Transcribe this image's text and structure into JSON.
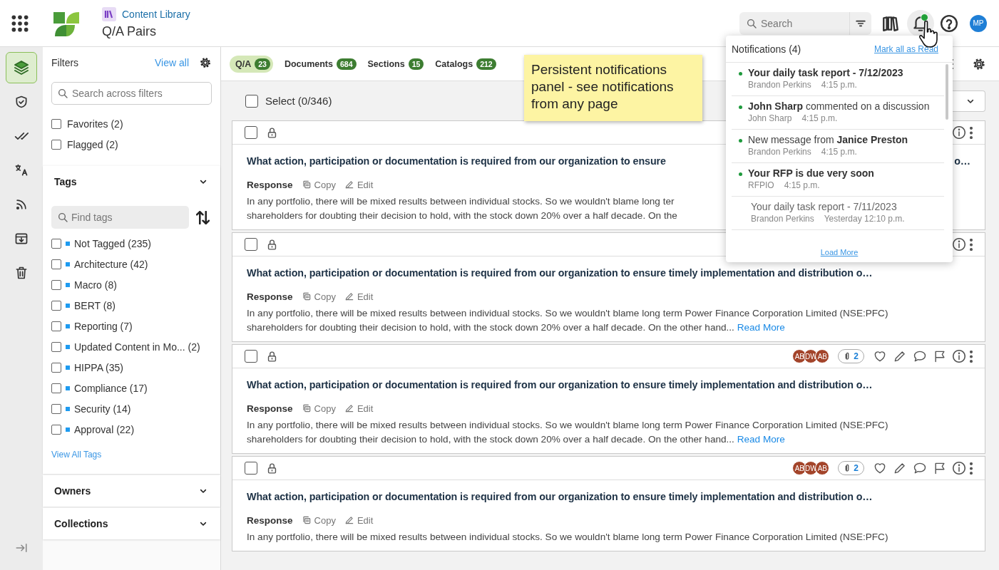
{
  "header": {
    "app_name": "Content Library",
    "page_title": "Q/A Pairs",
    "search": {
      "placeholder": "Search"
    },
    "notifications_unread": true,
    "avatar": "MP"
  },
  "rail": {
    "items": [
      {
        "selected": true
      },
      {
        "selected": false
      },
      {
        "selected": false
      },
      {
        "selected": false
      },
      {
        "selected": false
      },
      {
        "selected": false
      },
      {
        "selected": false
      }
    ]
  },
  "filters": {
    "title": "Filters",
    "view_all": "View all",
    "search": {
      "placeholder": "Search across filters"
    },
    "quick": [
      {
        "label": "Favorites (2)",
        "checked": false
      },
      {
        "label": "Flagged (2)",
        "checked": false
      }
    ],
    "sections": [
      {
        "title": "Tags",
        "expanded": true,
        "search": {
          "placeholder": "Find tags"
        },
        "items": [
          {
            "label": "Not Tagged (235)",
            "checked": false,
            "color": "#1e9bf0"
          },
          {
            "label": "Architecture (42)",
            "checked": false,
            "color": "#1e9bf0"
          },
          {
            "label": "Macro (8)",
            "checked": false,
            "color": "#1e9bf0"
          },
          {
            "label": "BERT (8)",
            "checked": false,
            "color": "#1e9bf0"
          },
          {
            "label": "Reporting (7)",
            "checked": false,
            "color": "#1e9bf0"
          },
          {
            "label": "Updated Content in Mo... (2)",
            "checked": false,
            "color": "#1e9bf0"
          },
          {
            "label": "HIPPA (35)",
            "checked": false,
            "color": "#1e9bf0"
          },
          {
            "label": "Compliance (17)",
            "checked": false,
            "color": "#1e9bf0"
          },
          {
            "label": "Security (14)",
            "checked": false,
            "color": "#1e9bf0"
          },
          {
            "label": "Approval (22)",
            "checked": false,
            "color": "#1e9bf0"
          }
        ],
        "link": "View All Tags"
      },
      {
        "title": "Owners",
        "expanded": false
      },
      {
        "title": "Collections",
        "expanded": false
      }
    ]
  },
  "tabs": [
    {
      "label": "Q/A",
      "count": "23",
      "selected": true
    },
    {
      "label": "Documents",
      "count": "684",
      "selected": false
    },
    {
      "label": "Sections",
      "count": "15",
      "selected": false
    },
    {
      "label": "Catalogs",
      "count": "212",
      "selected": false
    }
  ],
  "select_all": {
    "label": "Select (0/346)",
    "checked": false
  },
  "cards": [
    {
      "checked": false,
      "title": "What action, participation or documentation is required from our organization to ensure",
      "title_tail": "o…",
      "response_label": "Response",
      "copy": "Copy",
      "edit": "Edit",
      "body": [
        "In any portfolio, there will be mixed results between individual stocks. So we wouldn't blame long ter",
        "shareholders for doubting their decision to hold, with the stock down 20% over a half decade. On the"
      ]
    },
    {
      "checked": false,
      "title": "What action, participation or documentation is required from our organization to ensure timely implementation and distribution o…",
      "response_label": "Response",
      "copy": "Copy",
      "edit": "Edit",
      "body": [
        "In any portfolio, there will be mixed results between individual stocks. So we wouldn't blame long term Power Finance Corporation Limited (NSE:PFC)",
        "shareholders for doubting their decision to hold, with the stock down 20% over a half decade. On the other hand..."
      ],
      "read_more": "Read More"
    },
    {
      "checked": false,
      "avatars": [
        "AB",
        "DW",
        "AB"
      ],
      "attachments": "2",
      "title": "What action, participation or documentation is required from our organization to ensure timely implementation and distribution o…",
      "response_label": "Response",
      "copy": "Copy",
      "edit": "Edit",
      "body": [
        "In any portfolio, there will be mixed results between individual stocks. So we wouldn't blame long term Power Finance Corporation Limited (NSE:PFC)",
        "shareholders for doubting their decision to hold, with the stock down 20% over a half decade. On the other hand..."
      ],
      "read_more": "Read More"
    },
    {
      "checked": false,
      "avatars": [
        "AB",
        "DW",
        "AB"
      ],
      "attachments": "2",
      "title": "What action, participation or documentation is required from our organization to ensure timely implementation and distribution o…",
      "response_label": "Response",
      "copy": "Copy",
      "edit": "Edit",
      "body": [
        "In any portfolio, there will be mixed results between individual stocks. So we wouldn't blame long term Power Finance Corporation Limited (NSE:PFC)"
      ]
    }
  ],
  "notifications": {
    "title": "Notifications (4)",
    "mark_all": "Mark all as Read",
    "items": [
      {
        "text": "**Your daily task report - 7/12/2023**",
        "unread": true,
        "author": "Brandon Perkins",
        "time": "4:15 p.m."
      },
      {
        "text": "**John Sharp** commented on a discussion",
        "unread": true,
        "author": "John Sharp",
        "time": "4:15 p.m."
      },
      {
        "text": "New message from **Janice Preston**",
        "unread": true,
        "author": "Brandon Perkins",
        "time": "4:15 p.m."
      },
      {
        "text": "**Your RFP is due very soon**",
        "unread": true,
        "author": "RFPIO",
        "time": "4:15 p.m."
      },
      {
        "text": "Your daily task report - 7/11/2023",
        "unread": false,
        "author": "Brandon Perkins",
        "time": "Yesterday 12:10 p.m."
      }
    ],
    "load_more": "Load More"
  },
  "sticky_note": {
    "text": "Persistent notifications panel - see notifications from any page"
  }
}
